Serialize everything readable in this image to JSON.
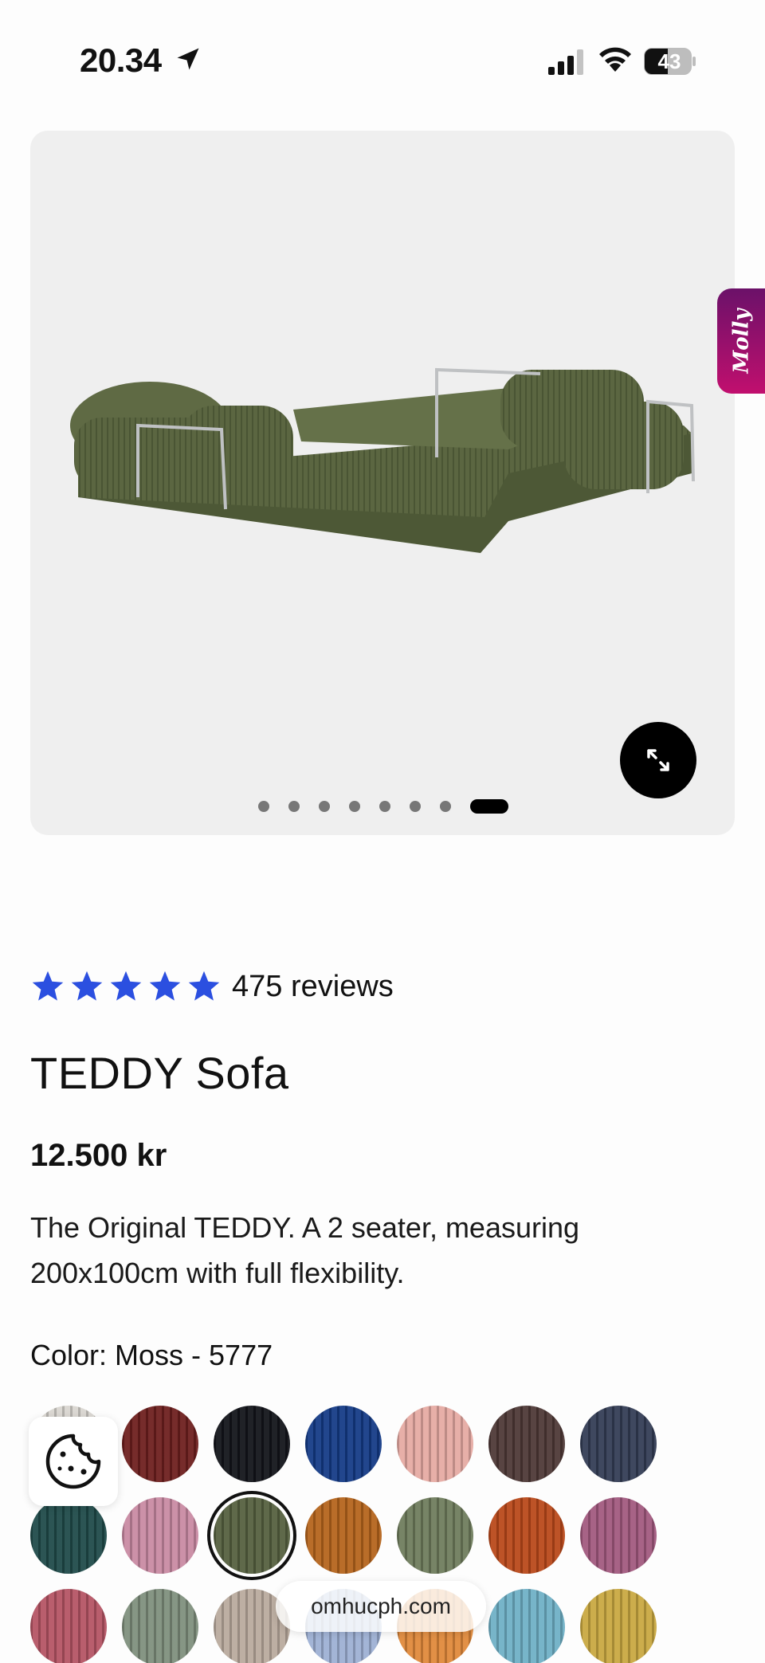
{
  "status_bar": {
    "time": "20.34",
    "battery": "43"
  },
  "gallery": {
    "image_alt": "TEDDY Sofa in Moss corduroy",
    "dot_count": 8,
    "active_index": 7
  },
  "chat_tab": {
    "label": "Molly"
  },
  "product": {
    "rating_stars": 5,
    "reviews_label": "475 reviews",
    "title": "TEDDY Sofa",
    "price": "12.500 kr",
    "description": "The Original TEDDY. A 2 seater, measuring 200x100cm with full flexibility.",
    "color_label": "Color: Moss - 5777"
  },
  "colors": {
    "star": "#2b4fe0",
    "molly_top": "#6b1169",
    "molly_bottom": "#c10f6e"
  },
  "swatches": [
    {
      "name": "light-grey",
      "color": "#d9d6d0"
    },
    {
      "name": "burgundy",
      "color": "#6e1f1e"
    },
    {
      "name": "black",
      "color": "#12141a"
    },
    {
      "name": "royal-blue",
      "color": "#143b86"
    },
    {
      "name": "blush-pink",
      "color": "#e6aaa3"
    },
    {
      "name": "chocolate",
      "color": "#4e3836"
    },
    {
      "name": "navy-grey",
      "color": "#333d55"
    },
    {
      "name": "teal",
      "color": "#1f4a49"
    },
    {
      "name": "rose",
      "color": "#c98aa3"
    },
    {
      "name": "moss",
      "color": "#55603f",
      "selected": true
    },
    {
      "name": "amber",
      "color": "#b5641c"
    },
    {
      "name": "sage",
      "color": "#6f7c5c"
    },
    {
      "name": "rust",
      "color": "#b9481a"
    },
    {
      "name": "mauve",
      "color": "#a2597f"
    },
    {
      "name": "raspberry",
      "color": "#b55464"
    },
    {
      "name": "eucalyptus",
      "color": "#7f8f7d"
    },
    {
      "name": "sand",
      "color": "#b9aa9d"
    },
    {
      "name": "powder-blue",
      "color": "#9db0d4"
    },
    {
      "name": "orange",
      "color": "#e0893a"
    },
    {
      "name": "aqua",
      "color": "#6fb0c6"
    },
    {
      "name": "mustard",
      "color": "#c9a841"
    }
  ],
  "browser": {
    "url": "omhucph.com"
  }
}
